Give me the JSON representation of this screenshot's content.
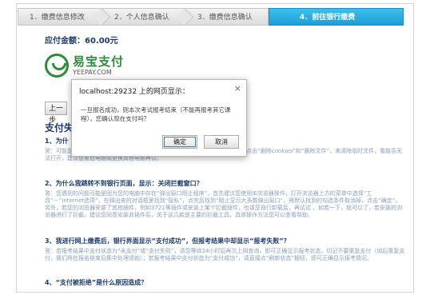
{
  "steps": [
    {
      "label": "1．缴费信息修改"
    },
    {
      "label": "2．个人信息确认"
    },
    {
      "label": "3．缴费信息确认"
    },
    {
      "label": "4．前往银行缴费"
    }
  ],
  "amount_text": "应付金额：60.00元",
  "logo": {
    "cn": "易宝支付",
    "en": "YEEPAY.COM"
  },
  "prev_button": "上一步",
  "faq_title": "支付失",
  "faq": [
    {
      "q": "1、为什",
      "a": "答：可能是您当时所选择的银行，请在浏览器菜单选择“工具”－“Internet选项”－点击“删除cookies”和“删除文件”，来清除临时文件，看能否无法打开，建议您重启电脑或更换其他电脑再试。"
    },
    {
      "q": "2、为什么我跳转不到银行页面，显示：关闭拦截窗口？",
      "a": "答：您遇到的问题可能是因为您的电脑中存在“弹出窗口阻止程序”，首先建议您使用IE浏览器操作，打开浏览器上方的菜单中选择“工具”－“Internet选项”，在弹出来的对话框里找到“隐私”，点完后找到“阻止显示大多数弹出窗口”，将默认找到的勾选条件取消掉，点击“确定”。另外，若您的浏览器安装了其他插件，例如3721等插件或安装上某个拦截插件，也请您自行卸载后，再试试 ，如若一下，就可以了，若安装的浏览器进行了拦截，建议您同意安装此插件后，关于这几款是主要的拦截工具，具体操作方法您可以查看帮助。"
    },
    {
      "q": "3、我进行网上缴费后，银行界面显示“支付成功”，但报考结果中却显示“报考失败”？",
      "a": "答：若报考结果中支付状态为“未支付”或“支付失败”，请您等待24小时后再次上网查询，即可正确显示报考状态，切记不要重复支付（如后重复支付，我们将在报名结束后集中处理退款）；若报考结果中支付状态为“支付成功”，请直接点“刷新状态”按钮，即可正确显示报考情况。"
    },
    {
      "q": "4、“支付被拒绝”是什么原因造成？",
      "a": ""
    }
  ],
  "dialog": {
    "title": "localhost:29232 上的网页显示：",
    "close_symbol": "×",
    "message": "一旦报名成功，则本次考试报考结束（不能再报考其它课程），您确认现在支付吗？",
    "ok_label": "确定",
    "cancel_label": "取消"
  }
}
